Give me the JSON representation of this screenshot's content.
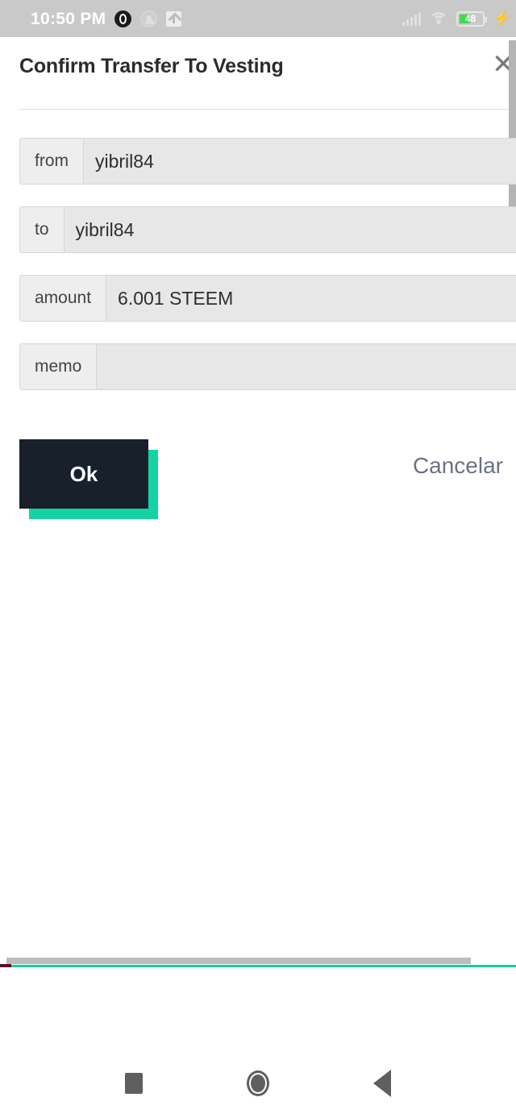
{
  "status_bar": {
    "time": "10:50 PM",
    "left_icons": [
      "chat-bubble-icon",
      "circle-app-icon",
      "upload-arrow-icon"
    ],
    "right_icons": [
      "signal-bars-icon",
      "wifi-icon",
      "battery-icon",
      "charging-bolt-icon"
    ],
    "battery_level": "48",
    "battery_color": "#3ddc4b",
    "background_color": "#c9c9c9"
  },
  "dialog": {
    "title": "Confirm Transfer To Vesting",
    "close_icon": "close-x-icon",
    "fields": [
      {
        "label": "from",
        "value": "yibril84"
      },
      {
        "label": "to",
        "value": "yibril84"
      },
      {
        "label": "amount",
        "value": "6.001 STEEM"
      },
      {
        "label": "memo",
        "value": ""
      }
    ],
    "actions": {
      "confirm_label": "Ok",
      "cancel_label": "Cancelar",
      "confirm_bg": "#18202c",
      "confirm_shadow": "#14d2a3",
      "cancel_color": "#6b7280"
    }
  },
  "nav_bar": {
    "recents_icon": "square-recents-icon",
    "home_icon": "circle-home-icon",
    "back_icon": "triangle-back-icon"
  },
  "accents": {
    "teal_line": "#14cfa2",
    "scrollbar": "#bdbdbd"
  }
}
